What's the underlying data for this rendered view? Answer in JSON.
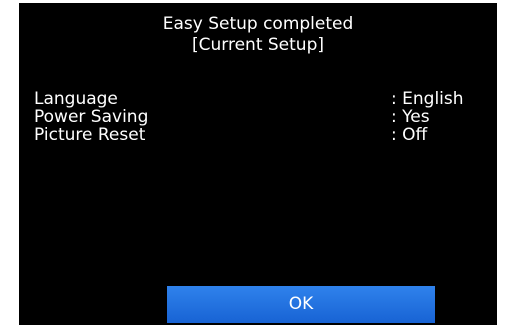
{
  "dialog": {
    "title_line1": "Easy Setup completed",
    "title_line2": "[Current Setup]"
  },
  "settings": [
    {
      "label": "Language",
      "value": ": English"
    },
    {
      "label": "Power Saving",
      "value": ": Yes"
    },
    {
      "label": "Picture Reset",
      "value": ": Off"
    }
  ],
  "actions": {
    "ok_label": "OK"
  },
  "colors": {
    "background": "#000000",
    "text": "#ffffff",
    "ok_button": "#1e6fdc"
  }
}
